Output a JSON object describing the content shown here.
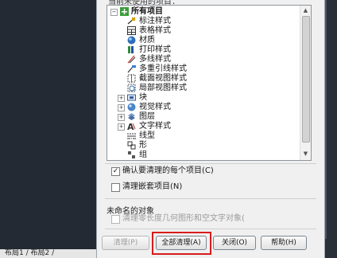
{
  "dialog": {
    "header_label": "当前未使用的项目：",
    "tree": {
      "root_label": "所有项目",
      "items": [
        {
          "label": "标注样式",
          "icon": "dimension-style-icon",
          "expandable": false
        },
        {
          "label": "表格样式",
          "icon": "table-style-icon",
          "expandable": false
        },
        {
          "label": "材质",
          "icon": "material-sphere-icon",
          "expandable": false
        },
        {
          "label": "打印样式",
          "icon": "plot-style-icon",
          "expandable": false
        },
        {
          "label": "多线样式",
          "icon": "multiline-style-icon",
          "expandable": false
        },
        {
          "label": "多重引线样式",
          "icon": "multileader-style-icon",
          "expandable": false
        },
        {
          "label": "截面视图样式",
          "icon": "section-view-style-icon",
          "expandable": false
        },
        {
          "label": "局部视图样式",
          "icon": "detail-view-style-icon",
          "expandable": false
        },
        {
          "label": "块",
          "icon": "block-icon",
          "expandable": true
        },
        {
          "label": "视觉样式",
          "icon": "visual-style-icon",
          "expandable": true
        },
        {
          "label": "图层",
          "icon": "layer-icon",
          "expandable": true
        },
        {
          "label": "文字样式",
          "icon": "text-style-icon",
          "expandable": true
        },
        {
          "label": "线型",
          "icon": "linetype-icon",
          "expandable": false
        },
        {
          "label": "形",
          "icon": "shape-icon",
          "expandable": false
        },
        {
          "label": "组",
          "icon": "group-icon",
          "expandable": false
        }
      ]
    },
    "options": {
      "confirm_each": {
        "label": "确认要清理的每个项目(C)",
        "checked": true
      },
      "purge_nested": {
        "label": "清理嵌套项目(N)",
        "checked": false
      }
    },
    "unnamed": {
      "title": "未命名的对象",
      "zero_length": {
        "label": "清理零长度几何图形和空文字对象(",
        "checked": false,
        "disabled": true
      }
    },
    "buttons": {
      "purge": "清理(P)",
      "purge_all": "全部清理(A)",
      "close": "关闭(O)",
      "help": "帮助(H)"
    }
  },
  "background": {
    "tabs_text": "布局1 / 布局2 /"
  },
  "colors": {
    "highlight": "#d71c1c",
    "root_icon": "#3b9c3b"
  }
}
